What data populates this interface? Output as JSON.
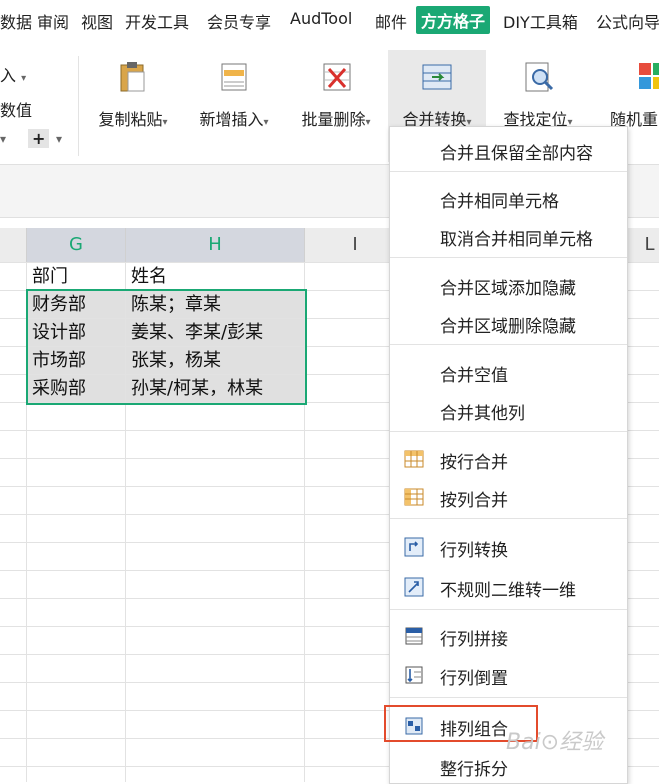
{
  "menu": {
    "items": [
      "数据",
      "审阅",
      "视图",
      "开发工具",
      "会员专享",
      "AudTool",
      "邮件",
      "方方格子",
      "DIY工具箱",
      "公式向导"
    ],
    "active_index": 7
  },
  "ribbon": {
    "left_fragments": [
      "入",
      "数值",
      "+"
    ],
    "buttons": [
      "复制粘贴",
      "新增插入",
      "批量删除",
      "合并转换",
      "查找定位",
      "随机重"
    ],
    "active_button": "合并转换"
  },
  "sheet": {
    "columns": [
      "G",
      "H",
      "I",
      "L"
    ],
    "selected_columns": [
      "G",
      "H"
    ],
    "rows": [
      {
        "dept": "部门",
        "names": "姓名"
      },
      {
        "dept": "财务部",
        "names": "陈某；章某"
      },
      {
        "dept": "设计部",
        "names": "姜某、李某/彭某"
      },
      {
        "dept": "市场部",
        "names": "张某，杨某"
      },
      {
        "dept": "采购部",
        "names": "孙某/柯某，林某"
      }
    ]
  },
  "dropdown": {
    "items": [
      {
        "label": "合并且保留全部内容",
        "icon": null
      },
      {
        "label": "合并相同单元格",
        "icon": null
      },
      {
        "label": "取消合并相同单元格",
        "icon": null
      },
      {
        "label": "合并区域添加隐藏",
        "icon": null
      },
      {
        "label": "合并区域删除隐藏",
        "icon": null
      },
      {
        "label": "合并空值",
        "icon": null
      },
      {
        "label": "合并其他列",
        "icon": null
      },
      {
        "label": "按行合并",
        "icon": "table-rows-icon"
      },
      {
        "label": "按列合并",
        "icon": "table-columns-icon"
      },
      {
        "label": "行列转换",
        "icon": "transpose-icon"
      },
      {
        "label": "不规则二维转一维",
        "icon": "convert-icon"
      },
      {
        "label": "行列拼接",
        "icon": "concat-icon"
      },
      {
        "label": "行列倒置",
        "icon": "reverse-icon"
      },
      {
        "label": "排列组合",
        "icon": "combination-icon"
      },
      {
        "label": "整行拆分",
        "icon": null
      }
    ],
    "highlighted": "排列组合"
  },
  "colors": {
    "accent": "#1aa874",
    "highlight_border": "#e34b2c"
  }
}
